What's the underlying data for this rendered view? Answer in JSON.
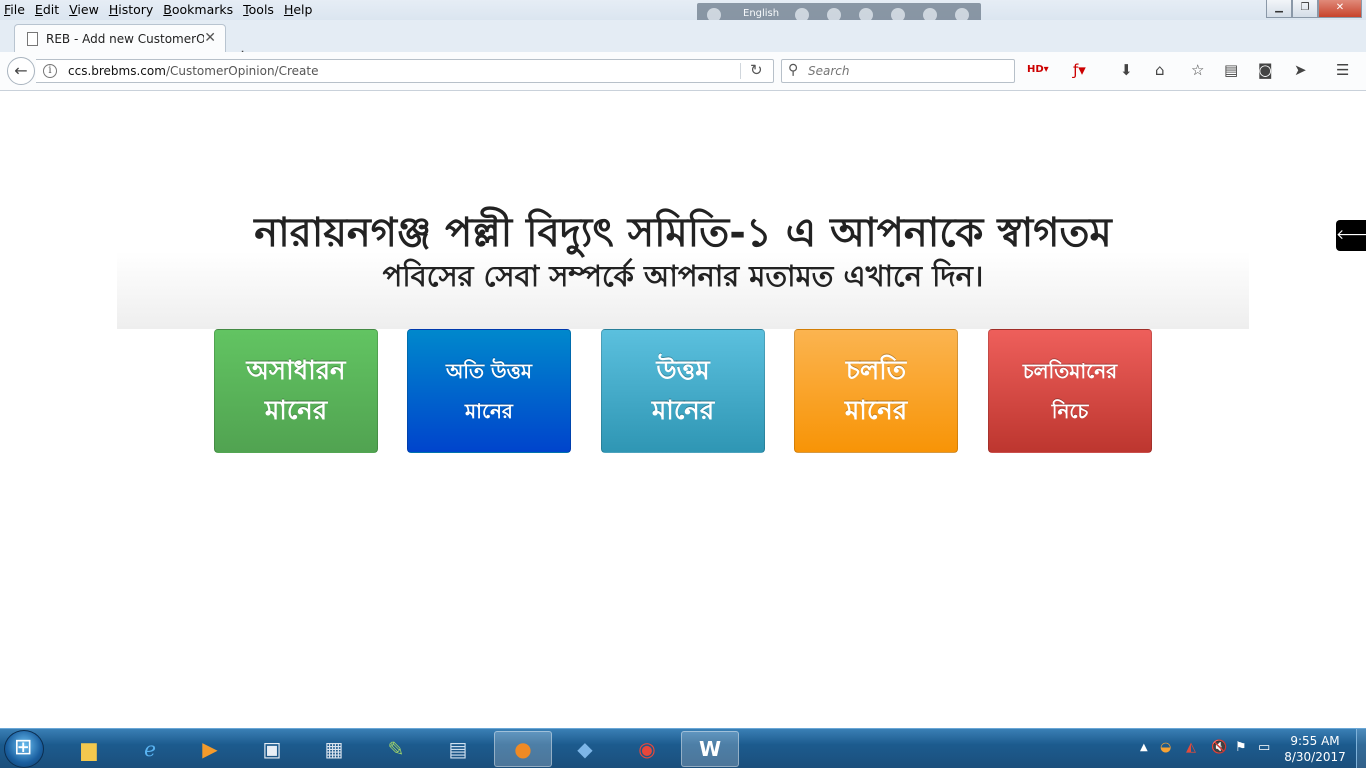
{
  "browser": {
    "menu": [
      "File",
      "Edit",
      "View",
      "History",
      "Bookmarks",
      "Tools",
      "Help"
    ],
    "ime_language": "English",
    "tab_title": "REB - Add new CustomerOpi",
    "url_host": "ccs.brebms.com",
    "url_path": "/CustomerOpinion/Create",
    "search_placeholder": "Search",
    "toolbar_icons": [
      "hd-icon",
      "flash-icon",
      "download-icon",
      "home-icon",
      "bookmark-star-icon",
      "reading-list-icon",
      "pocket-icon",
      "send-icon",
      "menu-icon"
    ]
  },
  "page": {
    "title": "নারায়নগঞ্জ পল্লী বিদ্যুৎ সমিতি-১ এ আপনাকে স্বাগতম",
    "subtitle": "পবিসের সেবা সম্পর্কে আপনার মতামত এখানে দিন।",
    "ratings": [
      {
        "line1": "অসাধারন",
        "line2": "মানের",
        "color": "#5bb75b"
      },
      {
        "line1": "অতি উত্তম",
        "line2": "মানের",
        "color": "#006dcc"
      },
      {
        "line1": "উত্তম",
        "line2": "মানের",
        "color": "#49afcd"
      },
      {
        "line1": "চলতি",
        "line2": "মানের",
        "color": "#faa732"
      },
      {
        "line1": "চলতিমানের",
        "line2": "নিচে",
        "color": "#da4f49"
      }
    ]
  },
  "taskbar": {
    "apps": [
      "file-explorer",
      "internet-explorer",
      "media-player",
      "control-panel",
      "calculator",
      "notepad-plus",
      "network-manager",
      "firefox",
      "internet-download",
      "chrome",
      "word"
    ],
    "time": "9:55 AM",
    "date": "8/30/2017"
  }
}
